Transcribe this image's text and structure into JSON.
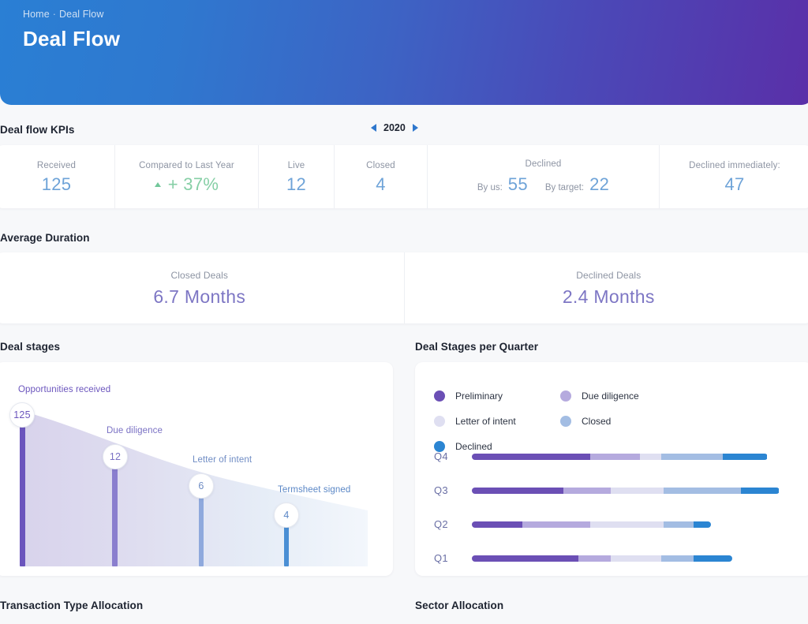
{
  "header": {
    "breadcrumb_home": "Home",
    "breadcrumb_sep": "·",
    "breadcrumb_current": "Deal Flow",
    "title": "Deal Flow"
  },
  "kpis": {
    "section_title": "Deal flow KPIs",
    "year": "2020",
    "prev_icon": "triangle-left-icon",
    "next_icon": "triangle-right-icon",
    "items": {
      "received_label": "Received",
      "received_value": "125",
      "compared_label": "Compared to Last Year",
      "compared_value": "+ 37%",
      "compared_trend_icon": "triangle-up-icon",
      "live_label": "Live",
      "live_value": "12",
      "closed_label": "Closed",
      "closed_value": "4",
      "declined_label": "Declined",
      "declined_by_us_label": "By us:",
      "declined_by_us_value": "55",
      "declined_by_target_label": "By target:",
      "declined_by_target_value": "22",
      "declined_immediately_label": "Declined immediately:",
      "declined_immediately_value": "47"
    }
  },
  "duration": {
    "section_title": "Average Duration",
    "closed_label": "Closed Deals",
    "closed_value": "6.7 Months",
    "declined_label": "Declined Deals",
    "declined_value": "2.4 Months"
  },
  "funnel": {
    "section_title": "Deal stages"
  },
  "quarterly": {
    "section_title": "Deal Stages per Quarter"
  },
  "bottom": {
    "transaction_title": "Transaction Type Allocation",
    "sector_title": "Sector Allocation"
  },
  "colors": {
    "preliminary": "#6b4fb5",
    "due_diligence": "#b5aade",
    "letter_of_intent": "#dfdff1",
    "closed": "#a3bde3",
    "declined": "#2b85d2",
    "kpi_blue": "#6ea3d8",
    "kpi_green": "#86cfa6",
    "duration_purple": "#7d76c4",
    "banner_start": "#2a7fd4",
    "banner_end": "#5a2fa8"
  },
  "chart_data": [
    {
      "type": "bar",
      "title": "Deal stages",
      "subtype": "funnel",
      "categories": [
        "Opportunities received",
        "Due diligence",
        "Letter of intent",
        "Termsheet signed"
      ],
      "values": [
        125,
        12,
        6,
        4
      ],
      "value_labels": [
        "125",
        "12",
        "6",
        "4"
      ],
      "bar_colors": [
        "#6b55bd",
        "#8a7ece",
        "#8fa9dd",
        "#4a8fd4"
      ],
      "label_colors": [
        "#6b55bd",
        "#7a71c4",
        "#6f8cc4",
        "#5b87c6"
      ],
      "xlabel": "",
      "ylabel": "",
      "grid": false,
      "legend": "none"
    },
    {
      "type": "bar",
      "subtype": "stacked-horizontal",
      "title": "Deal Stages per Quarter",
      "categories": [
        "Q4",
        "Q3",
        "Q2",
        "Q1"
      ],
      "series": [
        {
          "name": "Preliminary",
          "color": "#6b4fb5",
          "values": [
            40,
            31,
            17,
            36
          ]
        },
        {
          "name": "Due diligence",
          "color": "#b5aade",
          "values": [
            17,
            16,
            23,
            11
          ]
        },
        {
          "name": "Letter of intent",
          "color": "#dfdff1",
          "values": [
            7,
            18,
            25,
            17
          ]
        },
        {
          "name": "Closed",
          "color": "#a3bde3",
          "values": [
            21,
            26,
            10,
            11
          ]
        },
        {
          "name": "Declined",
          "color": "#2b85d2",
          "values": [
            15,
            13,
            6,
            13
          ]
        }
      ],
      "axis_max": 110,
      "xlabel": "",
      "ylabel": "",
      "grid": false,
      "legend": "top"
    }
  ]
}
